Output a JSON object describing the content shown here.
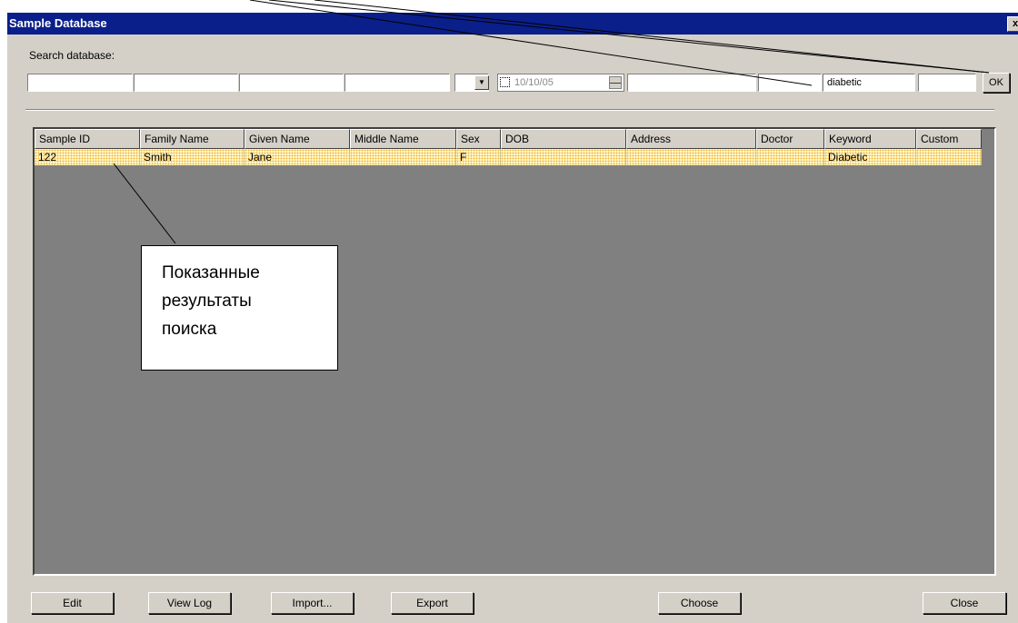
{
  "window": {
    "title": "Sample Database",
    "close_glyph": "x"
  },
  "search": {
    "label": "Search database:",
    "fields": [
      "",
      "",
      "",
      "",
      "",
      "",
      "",
      "diabetic",
      ""
    ],
    "date_value": "10/10/05",
    "ok_label": "OK"
  },
  "table": {
    "columns": [
      "Sample ID",
      "Family Name",
      "Given Name",
      "Middle Name",
      "Sex",
      "DOB",
      "Address",
      "Doctor",
      "Keyword",
      "Custom"
    ],
    "rows": [
      [
        "122",
        "Smith",
        "Jane",
        "",
        "F",
        "",
        "",
        "",
        "Diabetic",
        ""
      ]
    ]
  },
  "buttons": {
    "edit": "Edit",
    "view_log": "View Log",
    "import": "Import...",
    "export": "Export",
    "choose": "Choose",
    "close": "Close"
  },
  "callout": {
    "line1": "Показанные",
    "line2": "результаты",
    "line3": "поиска"
  },
  "colors": {
    "titlebar": "#0a1f8a",
    "window_bg": "#d4d0c8",
    "grid_bg": "#808080",
    "row_highlight": "#fff9c8"
  }
}
